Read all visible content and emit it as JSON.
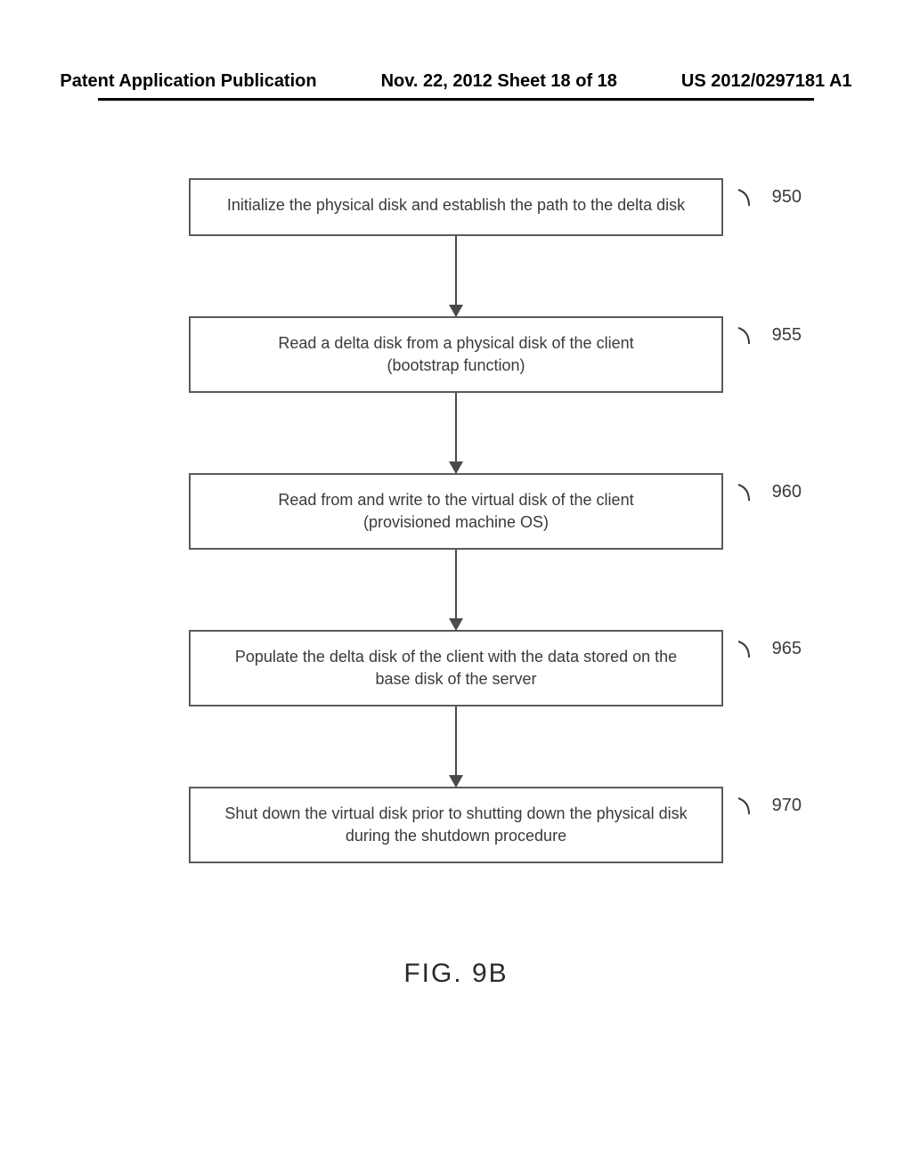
{
  "header": {
    "left": "Patent Application Publication",
    "center": "Nov. 22, 2012  Sheet 18 of 18",
    "right": "US 2012/0297181 A1"
  },
  "flow": {
    "nodes": [
      {
        "ref": "950",
        "text1": "Initialize the physical disk and establish the path to the delta disk",
        "text2": ""
      },
      {
        "ref": "955",
        "text1": "Read a delta disk from a physical disk of the client",
        "text2": "(bootstrap function)"
      },
      {
        "ref": "960",
        "text1": "Read from and write to the virtual disk of the client",
        "text2": "(provisioned machine OS)"
      },
      {
        "ref": "965",
        "text1": "Populate the delta disk of the client with the data stored on the",
        "text2": "base disk of the server"
      },
      {
        "ref": "970",
        "text1": "Shut down the virtual disk prior to shutting down the physical disk",
        "text2": "during the shutdown procedure"
      }
    ]
  },
  "figure_caption": "FIG. 9B"
}
